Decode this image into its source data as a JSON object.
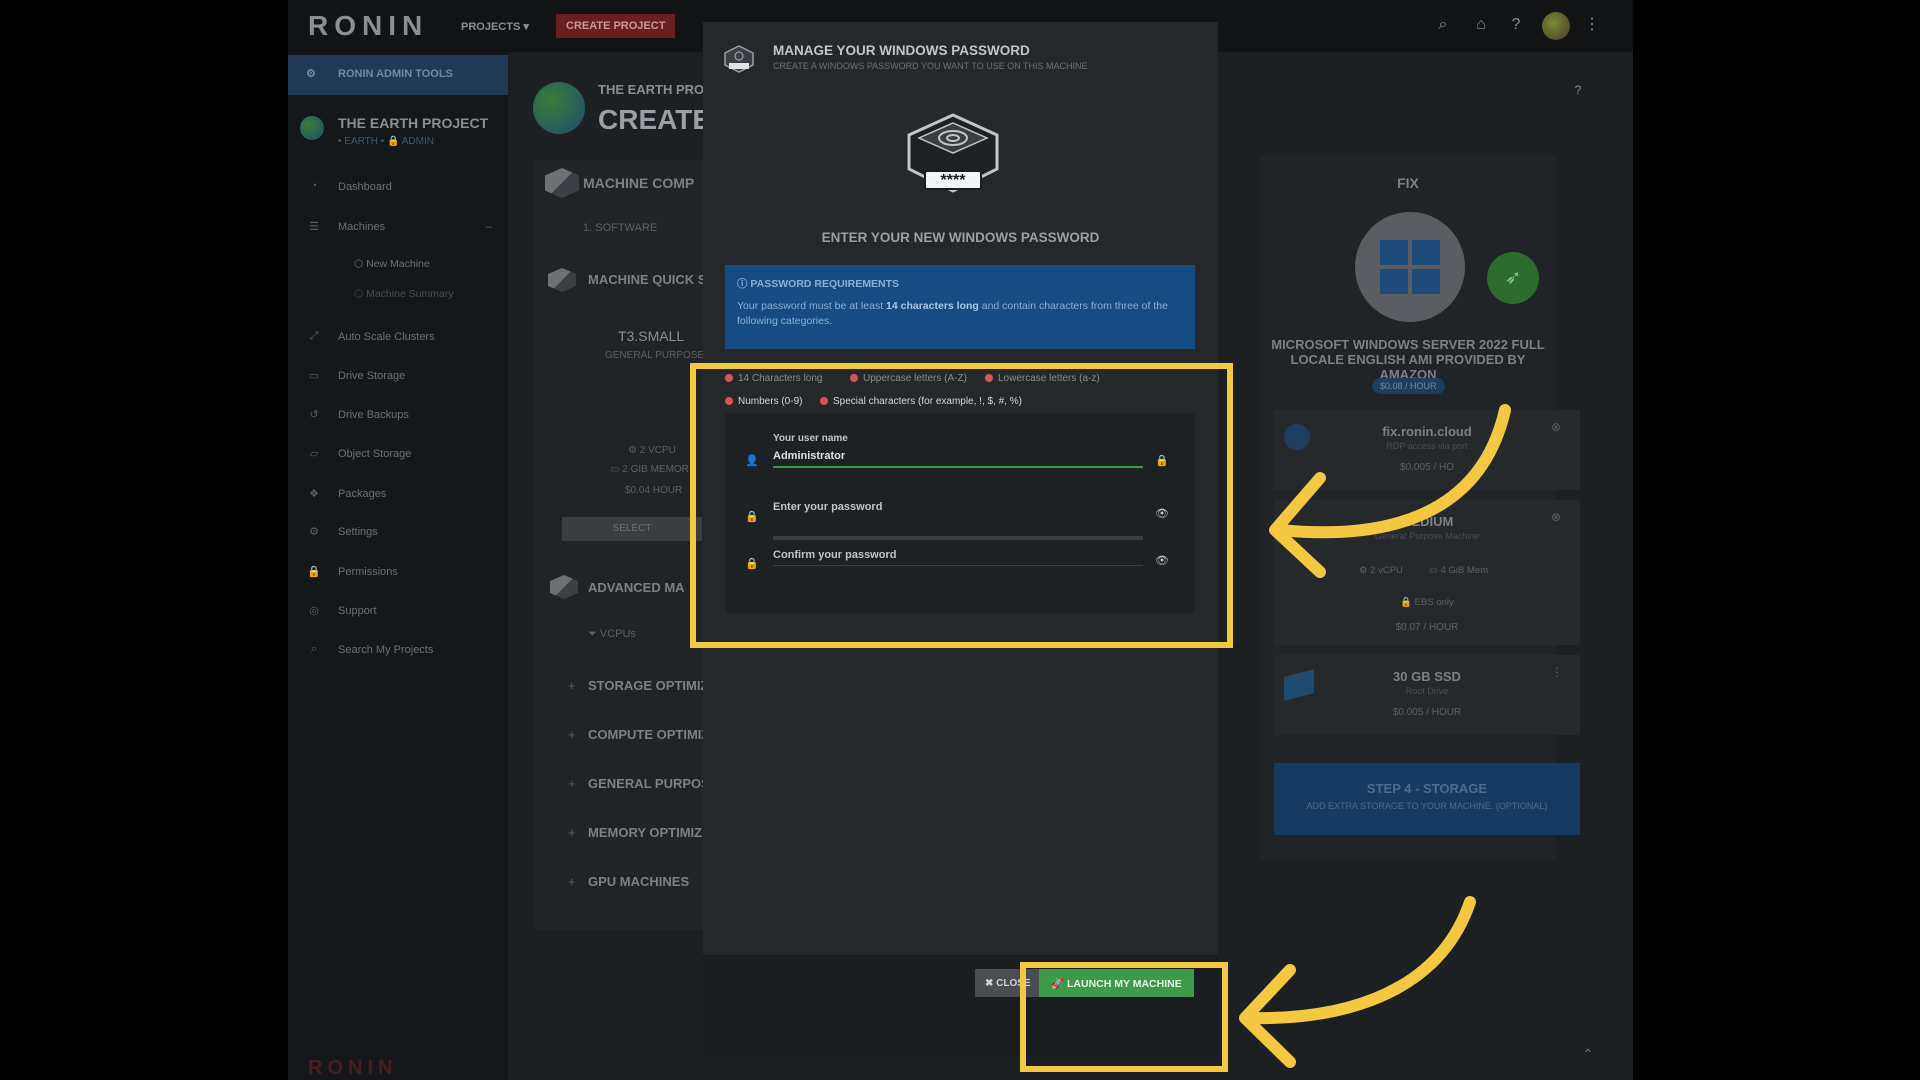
{
  "topbar": {
    "logo": "RONIN",
    "projects_label": "PROJECTS ▾",
    "create_project_label": "CREATE PROJECT",
    "icons": [
      "search-icon",
      "home-icon",
      "help-icon",
      "avatar",
      "more-icon"
    ]
  },
  "sidebar": {
    "admin_tools": "RONIN ADMIN TOOLS",
    "project_title": "THE EARTH PROJECT",
    "project_sub": "• EARTH •  🔒 ADMIN",
    "items": [
      {
        "label": "Dashboard",
        "icon": "dashboard-icon"
      },
      {
        "label": "Machines",
        "icon": "machines-icon"
      },
      {
        "label": "Auto Scale Clusters",
        "icon": "cluster-icon"
      },
      {
        "label": "Drive Storage",
        "icon": "drive-icon"
      },
      {
        "label": "Drive Backups",
        "icon": "backup-icon"
      },
      {
        "label": "Object Storage",
        "icon": "folder-icon"
      },
      {
        "label": "Packages",
        "icon": "package-icon"
      },
      {
        "label": "Settings",
        "icon": "gear-icon"
      },
      {
        "label": "Permissions",
        "icon": "lock-icon"
      },
      {
        "label": "Support",
        "icon": "support-icon"
      },
      {
        "label": "Search My Projects",
        "icon": "search-icon"
      }
    ],
    "sub_items": [
      "New Machine",
      "Machine Summary"
    ],
    "brand": "RONIN"
  },
  "main": {
    "head_small": "THE EARTH PRO",
    "head_big": "CREATE",
    "machine_comp": "MACHINE COMP",
    "step1": "1. SOFTWARE",
    "quick": "MACHINE QUICK S",
    "machine_name": "T3.SMALL",
    "machine_type": "GENERAL PURPOSE",
    "vcpu": "⚙ 2 VCPU",
    "mem": "▭ 2 GIB MEMOR",
    "price": "$0.04 HOUR",
    "select_label": "SELECT",
    "advanced": "ADVANCED MA",
    "vcpus_filter": "VCPUs",
    "categories": [
      "STORAGE OPTIMIZ",
      "COMPUTE OPTIMIZ",
      "GENERAL PURPOS",
      "MEMORY OPTIMIZE",
      "GPU MACHINES"
    ]
  },
  "right": {
    "fix_title": "FIX",
    "os_title": "MICROSOFT WINDOWS SERVER 2022 FULL LOCALE ENGLISH AMI PROVIDED BY AMAZON",
    "price_badge": "$0.08 / HOUR",
    "card1_title": "fix.ronin.cloud",
    "card1_sub": "RDP access via port",
    "card1_price": "$0.005 / HO",
    "card2_title": "MEDIUM",
    "card2_sub": "General Purpose Machine",
    "card2_vcpu": "⚙ 2 vCPU",
    "card2_mem": "▭ 4 GiB Mem",
    "card2_ebs": "🔒 EBS only",
    "card2_price": "$0.07 / HOUR",
    "card3_title": "30 GB SSD",
    "card3_sub": "Root Drive",
    "card3_price": "$0.005 / HOUR",
    "step4_title": "STEP 4 - STORAGE",
    "step4_sub": "ADD EXTRA STORAGE TO YOUR MACHINE. (OPTIONAL)"
  },
  "modal": {
    "title": "MANAGE YOUR WINDOWS PASSWORD",
    "subtitle": "CREATE A WINDOWS PASSWORD YOU WANT TO USE ON THIS MACHINE",
    "icon_stars": "****",
    "enter_title": "ENTER YOUR NEW WINDOWS PASSWORD",
    "req_title": "PASSWORD REQUIREMENTS",
    "req_text_1": "Your password must be at least ",
    "req_text_bold": "14 characters long",
    "req_text_2": " and contain characters from three of the following categories.",
    "chips": [
      "14 Characters long",
      "Uppercase letters (A-Z)",
      "Lowercase letters (a-z)",
      "Numbers (0-9)",
      "Special characters (for example, !, $, #, %)"
    ],
    "username_label": "Your user name",
    "username_value": "Administrator",
    "password_placeholder": "Enter your password",
    "confirm_placeholder": "Confirm your password",
    "close_label": "✖ CLOSE",
    "launch_label": "🚀 LAUNCH MY MACHINE"
  },
  "colors": {
    "highlight": "#f5c842",
    "launch_green": "#3c9a4a",
    "requirements_blue": "#164c84",
    "requirement_dot": "#d9545a"
  }
}
